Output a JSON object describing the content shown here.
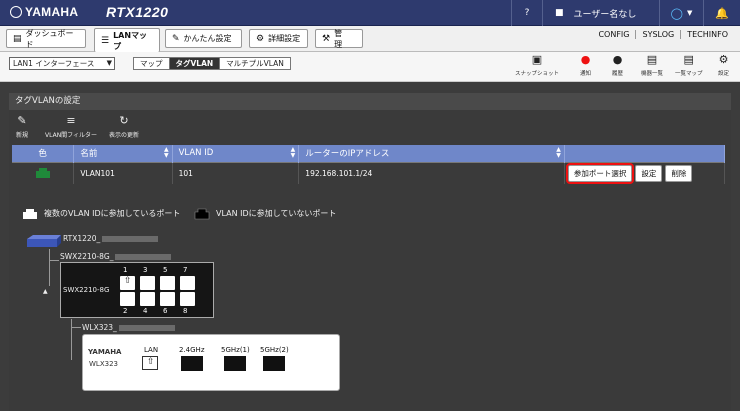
{
  "header": {
    "brand": "YAMAHA",
    "model": "RTX1220",
    "help": "?",
    "user": "ユーザー名なし",
    "status_icon": "circle-status-icon",
    "bell_icon": "bell-icon"
  },
  "tabs": [
    {
      "label": "ダッシュボード",
      "icon": "dashboard-icon"
    },
    {
      "label": "LANマップ",
      "icon": "map-icon"
    },
    {
      "label": "かんたん設定",
      "icon": "wizard-icon"
    },
    {
      "label": "詳細設定",
      "icon": "gear-icon"
    },
    {
      "label": "管　理",
      "icon": "tool-icon"
    }
  ],
  "links": [
    "CONFIG",
    "SYSLOG",
    "TECHINFO"
  ],
  "interface_select": "LAN1 インターフェース",
  "view_modes": [
    "マップ",
    "タグVLAN",
    "マルチプルVLAN"
  ],
  "active_view": "タグVLAN",
  "right_tools": [
    {
      "label": "スナップショット",
      "icon": "camera-icon"
    },
    {
      "label": "通知",
      "icon": "alert-icon"
    },
    {
      "label": "履歴",
      "icon": "history-icon"
    },
    {
      "label": "機器一覧",
      "icon": "list-icon"
    },
    {
      "label": "一覧マップ",
      "icon": "map-list-icon"
    },
    {
      "label": "設定",
      "icon": "gear-icon"
    }
  ],
  "panel": {
    "title": "タグVLANの設定",
    "tools": [
      {
        "label": "新規",
        "icon": "edit-icon"
      },
      {
        "label": "VLAN間フィルター",
        "icon": "filter-icon"
      },
      {
        "label": "表示の更新",
        "icon": "refresh-icon"
      }
    ],
    "columns": [
      "色",
      "名前",
      "VLAN ID",
      "ルーターのIPアドレス"
    ],
    "rows": [
      {
        "color": "#1f8a3a",
        "name": "VLAN101",
        "vlan_id": "101",
        "ip": "192.168.101.1/24",
        "actions": [
          "参加ポート選択",
          "設定",
          "削除"
        ]
      }
    ]
  },
  "legend": {
    "multi": "複数のVLAN IDに参加しているポート",
    "none": "VLAN IDに参加していないポート"
  },
  "devices": {
    "router": "RTX1220_",
    "switch_name": "SWX2210-8G_",
    "switch_model": "SWX2210-8G",
    "switch_ports_top": [
      "1",
      "3",
      "5",
      "7"
    ],
    "switch_ports_bottom": [
      "2",
      "4",
      "6",
      "8"
    ],
    "ap_name": "WLX323_",
    "ap_brand": "YAMAHA",
    "ap_model": "WLX323",
    "ap_lan": "LAN",
    "ap_bands": [
      "2.4GHz",
      "5GHz(1)",
      "5GHz(2)"
    ]
  },
  "colors": {
    "header": "#2e3a6e",
    "table_header": "#6f87c9",
    "highlight": "#e11111",
    "vlan_green": "#1f8a3a"
  }
}
